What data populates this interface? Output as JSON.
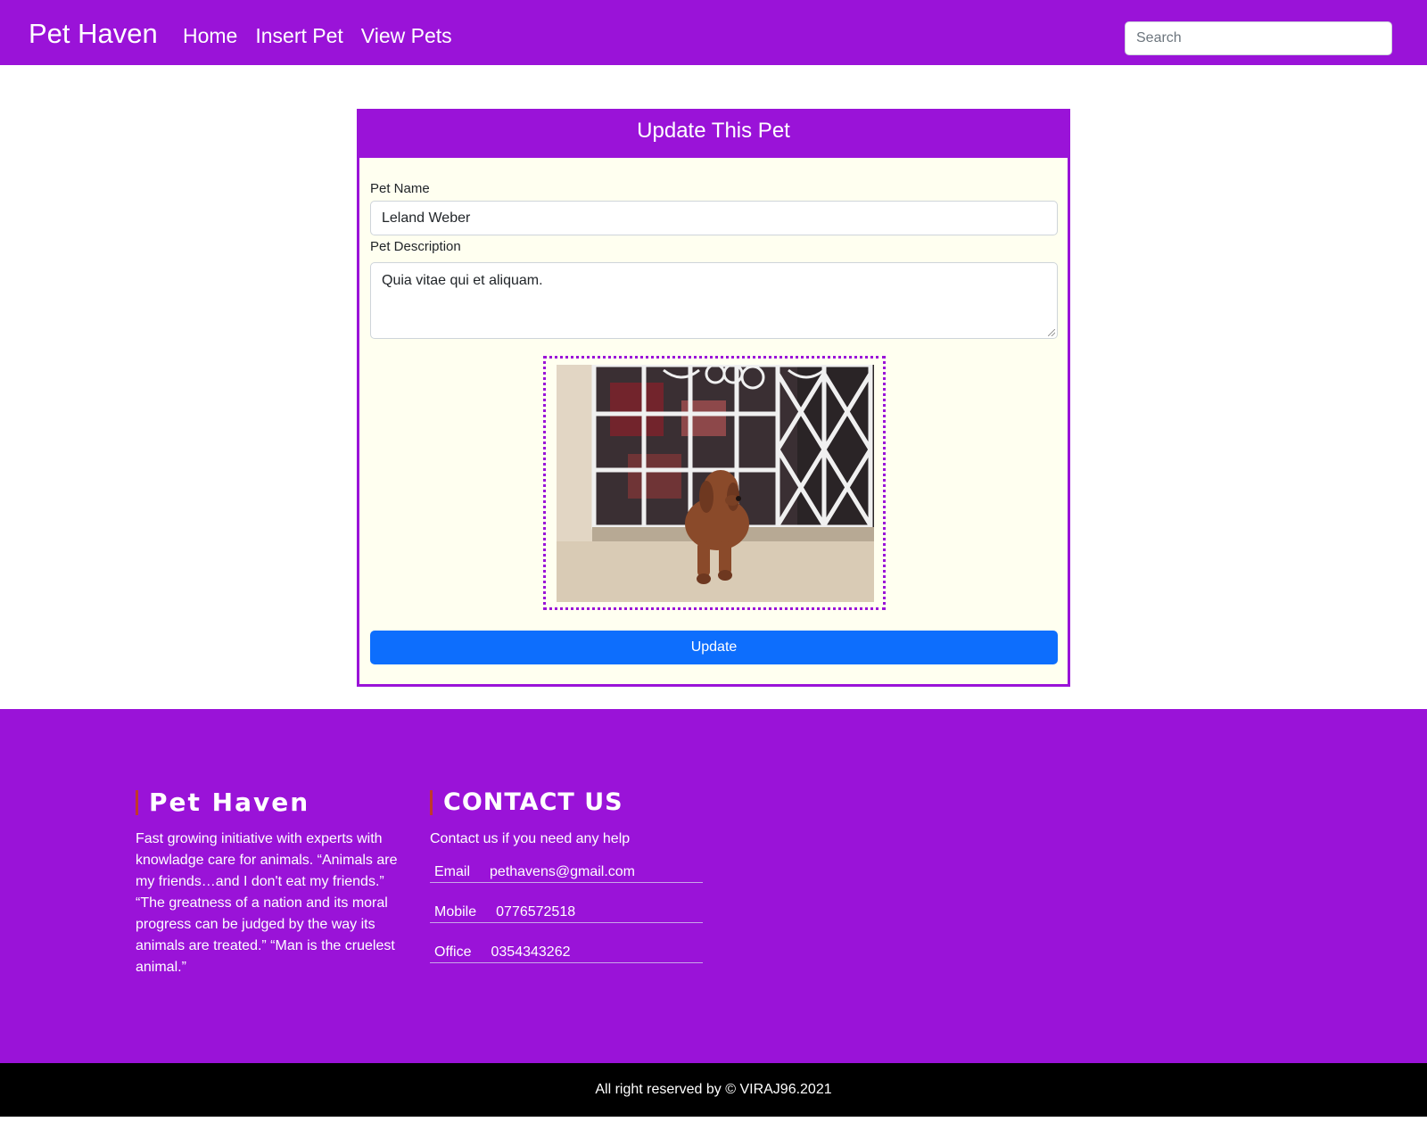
{
  "navbar": {
    "brand": "Pet Haven",
    "links": [
      {
        "label": "Home"
      },
      {
        "label": "Insert Pet"
      },
      {
        "label": "View Pets"
      }
    ],
    "search_placeholder": "Search"
  },
  "card": {
    "title": "Update This Pet",
    "pet_name_label": "Pet Name",
    "pet_name_value": "Leland Weber",
    "pet_description_label": "Pet Description",
    "pet_description_value": "Quia vitae qui et aliquam.",
    "update_label": "Update"
  },
  "footer": {
    "about_title": "Pet Haven",
    "about_text": "Fast growing initiative with experts with knowladge care for animals. “Animals are my friends…and I don't eat my friends.” “The greatness of a nation and its moral progress can be judged by the way its animals are treated.” “Man is the cruelest animal.”",
    "contact_title": "CONTACT US",
    "contact_text": "Contact us if you need any help",
    "contacts": [
      {
        "label": "Email",
        "value": "pethavens@gmail.com"
      },
      {
        "label": "Mobile",
        "value": "0776572518"
      },
      {
        "label": "Office",
        "value": "0354343262"
      }
    ]
  },
  "copyright": "All right reserved by © VIRAJ96.2021",
  "colors": {
    "primary": "#9a13d8",
    "button": "#0d6efd",
    "card_bg": "#fffff0"
  }
}
